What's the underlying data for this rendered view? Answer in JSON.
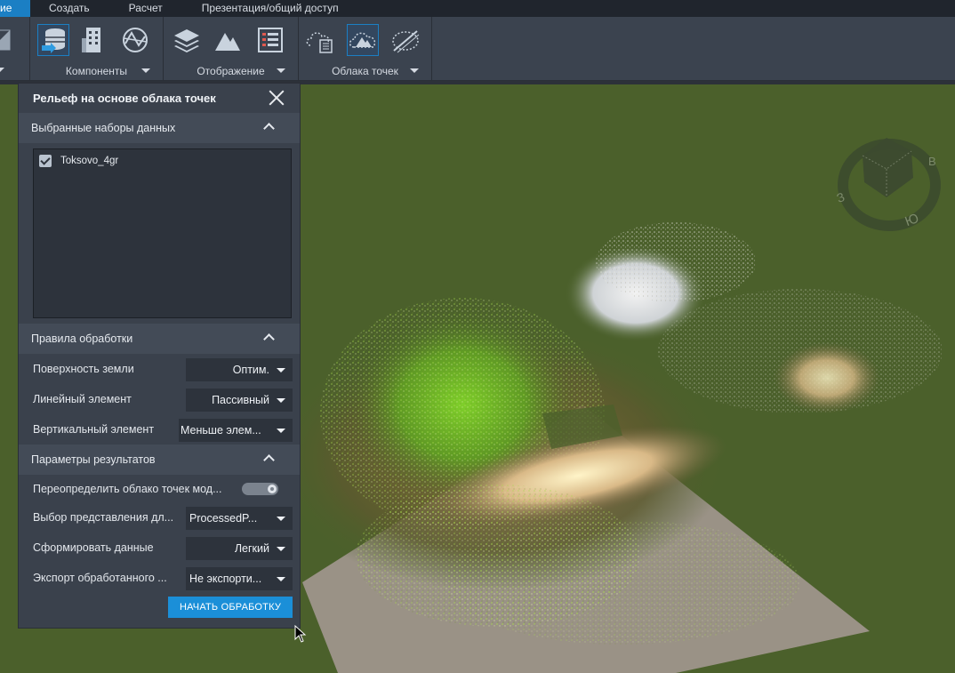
{
  "menu": {
    "tabs": [
      {
        "label": "ие"
      },
      {
        "label": "Создать"
      },
      {
        "label": "Расчет"
      },
      {
        "label": "Презентация/общий доступ"
      }
    ]
  },
  "ribbon": {
    "groups": [
      {
        "label": "Компоненты"
      },
      {
        "label": "Отображение"
      },
      {
        "label": "Облака точек"
      }
    ]
  },
  "panel": {
    "title": "Рельеф на основе облака точек",
    "datasets_section": "Выбранные наборы данных",
    "datasets": [
      {
        "name": "Toksovo_4gr",
        "checked": true
      }
    ],
    "rules_section": "Правила обработки",
    "rules": [
      {
        "label": "Поверхность земли",
        "value": "Оптим."
      },
      {
        "label": "Линейный элемент",
        "value": "Пассивный"
      },
      {
        "label": "Вертикальный элемент",
        "value": "Меньше элем..."
      }
    ],
    "results_section": "Параметры результатов",
    "override_label": "Переопределить облако точек мод...",
    "override_on": false,
    "results": [
      {
        "label": "Выбор представления дл...",
        "value": "ProcessedP..."
      },
      {
        "label": "Сформировать данные",
        "value": "Легкий"
      },
      {
        "label": "Экспорт обработанного ...",
        "value": "Не экспорти..."
      }
    ],
    "run_button": "НАЧАТЬ ОБРАБОТКУ"
  },
  "compass": {
    "west": "З",
    "east": "В",
    "south": "Ю"
  },
  "colors": {
    "accent": "#1b8fd8",
    "panel_bg": "#3a414c",
    "viewport_bg": "#4b602b"
  }
}
